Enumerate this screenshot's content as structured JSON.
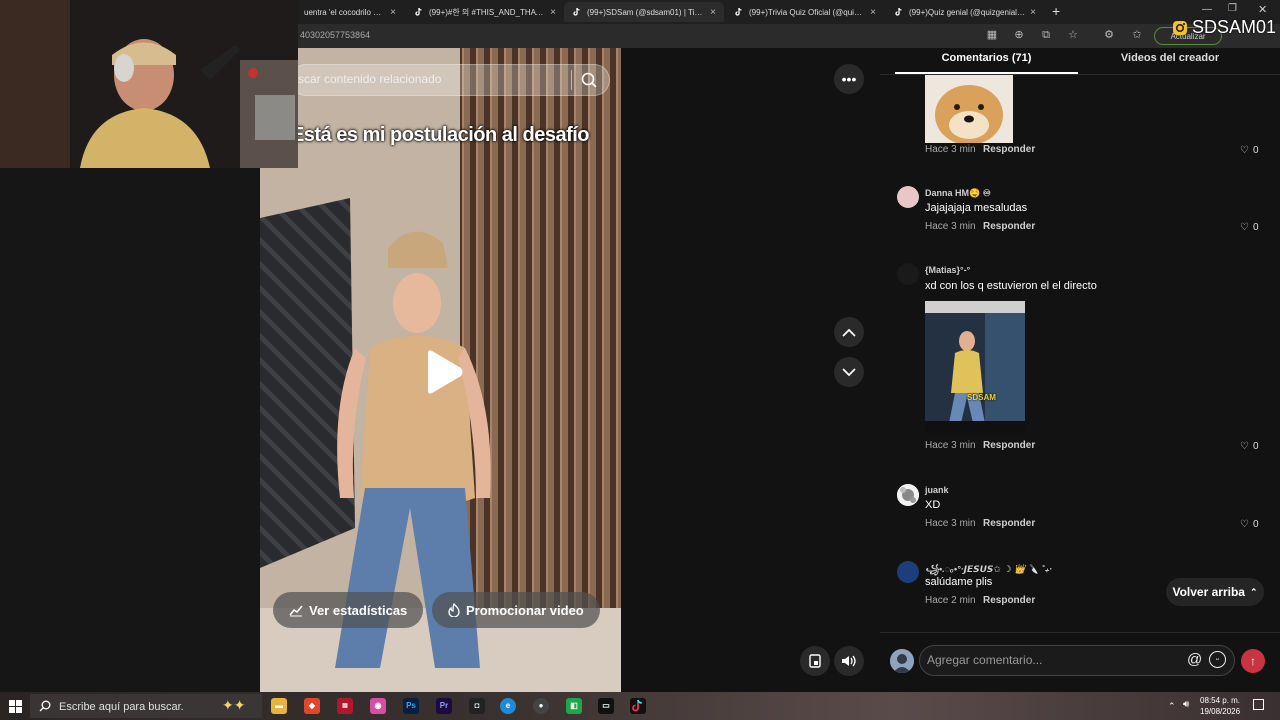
{
  "browser": {
    "tabs": [
      {
        "label": "uentra 'el cocodrilo dani"
      },
      {
        "label": "(99+)#한 의 #THIS_AND_THAT Cl"
      },
      {
        "label": "(99+)SDSam (@sdsam01) | TikTok"
      },
      {
        "label": "(99+)Trivia Quiz Oficial (@quiz_tr"
      },
      {
        "label": "(99+)Quiz genial (@quizgeniales)"
      }
    ],
    "new_tab": "+",
    "url": "40302057753864",
    "update_button": "Actualizar"
  },
  "watermark": {
    "handle": "SDSAM01"
  },
  "video": {
    "search_placeholder": "scar contenido relacionado",
    "caption": "Está es mi postulación al desafío",
    "stats_button": "Ver estadísticas",
    "promote_button": "Promocionar video"
  },
  "comments_panel": {
    "tab_comments": "Comentarios (71)",
    "tab_creator": "Videos del creador",
    "comments": [
      {
        "name": "",
        "text": "",
        "time": "Hace 3 min",
        "reply": "Responder",
        "likes": "0"
      },
      {
        "name": "Danna HM🤤 ♾",
        "text": "Jajajajaja mesaludas",
        "time": "Hace 3 min",
        "reply": "Responder",
        "likes": "0"
      },
      {
        "name": "{Matias}°-°",
        "text": "xd con los q estuvieron el el directo",
        "time": "Hace 3 min",
        "reply": "Responder",
        "likes": "0",
        "image_label": "SDSAM"
      },
      {
        "name": "juank",
        "text": "XD",
        "time": "Hace 3 min",
        "reply": "Responder",
        "likes": "0"
      },
      {
        "name": "꧁•.◌ₒ•°·𝙅𝙀𝙎𝙐𝙎✩ ☽ 👑 🔪 ˚₊·",
        "text": "salúdame plis",
        "time": "Hace 2 min",
        "reply": "Responder"
      }
    ],
    "back_to_top": "Volver arriba",
    "input_placeholder": "Agregar comentario..."
  },
  "taskbar": {
    "search_placeholder": "Escribe aquí para buscar.",
    "time": "08:54 p. m.",
    "date": "19/08/2026"
  },
  "colors": {
    "accent_red": "#c8343f",
    "tiktok_cyan": "#25f4ee",
    "tiktok_red": "#fe2c55"
  }
}
